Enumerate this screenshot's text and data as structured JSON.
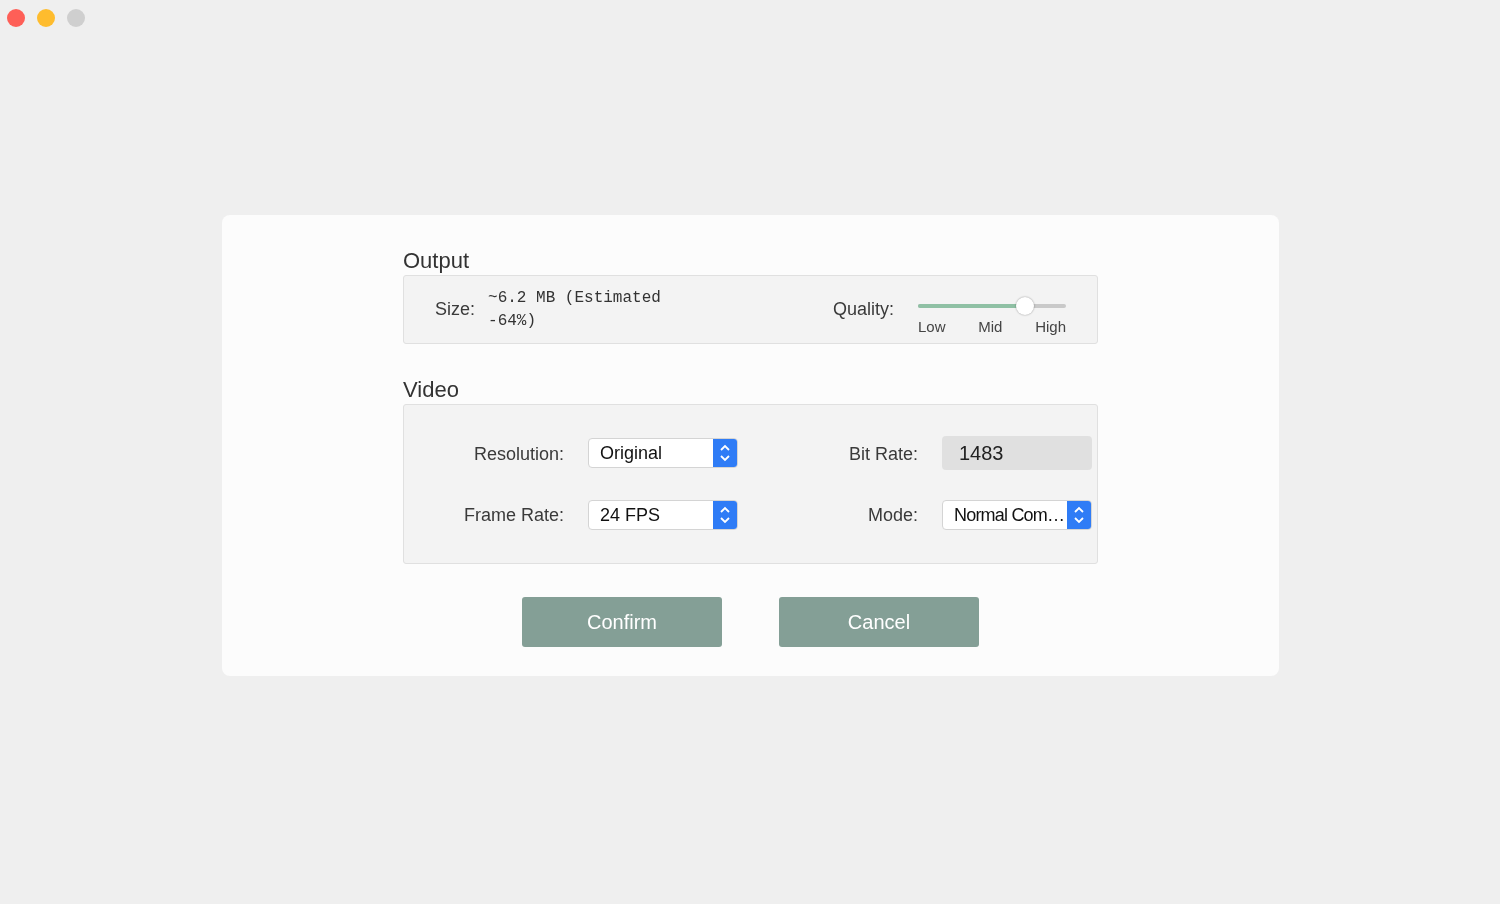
{
  "output": {
    "title": "Output",
    "size_label": "Size:",
    "size_value": "~6.2 MB (Estimated -64%)",
    "quality_label": "Quality:",
    "quality": {
      "level": 0.72,
      "ticks": [
        "Low",
        "Mid",
        "High"
      ]
    }
  },
  "video": {
    "title": "Video",
    "fields": [
      {
        "kind": "select",
        "label": "Resolution:",
        "value": "Original"
      },
      {
        "kind": "input",
        "label": "Bit Rate:",
        "value": "1483",
        "disabled": true
      },
      {
        "kind": "select",
        "label": "Frame Rate:",
        "value": "24 FPS"
      },
      {
        "kind": "select",
        "label": "Mode:",
        "value": "Normal Com…"
      }
    ]
  },
  "buttons": [
    "Confirm",
    "Cancel"
  ]
}
